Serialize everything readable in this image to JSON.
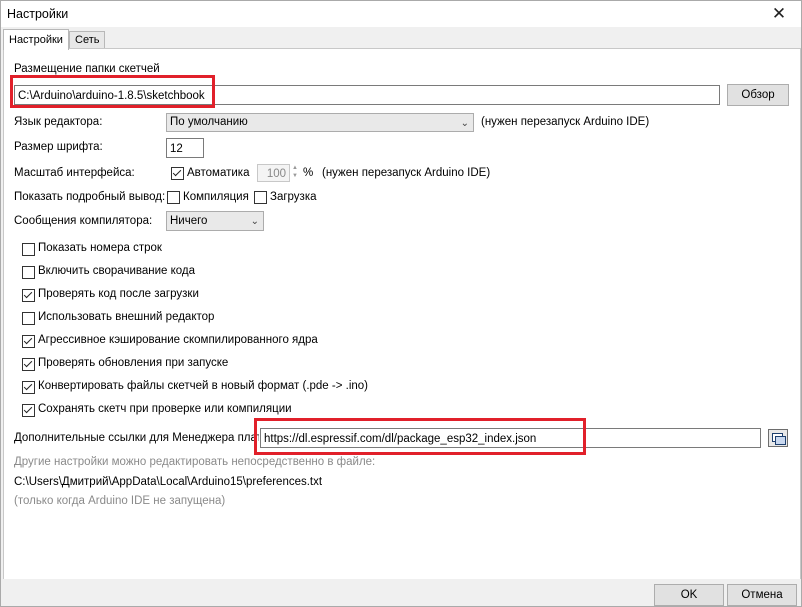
{
  "window": {
    "title": "Настройки"
  },
  "tabs": [
    {
      "label": "Настройки",
      "active": true
    },
    {
      "label": "Сеть",
      "active": false
    }
  ],
  "sketchbook": {
    "label": "Размещение папки скетчей",
    "path": "C:\\Arduino\\arduino-1.8.5\\sketchbook",
    "browse_label": "Обзор"
  },
  "editor_language": {
    "label": "Язык редактора:",
    "value": "По умолчанию",
    "note": "(нужен перезапуск Arduino IDE)"
  },
  "font_size": {
    "label": "Размер шрифта:",
    "value": "12"
  },
  "ui_scale": {
    "label": "Масштаб интерфейса:",
    "auto_label": "Автоматика",
    "auto_checked": true,
    "value": "100",
    "unit": "%",
    "note": "(нужен перезапуск Arduino IDE)"
  },
  "verbose": {
    "label": "Показать подробный вывод:",
    "compile_label": "Компиляция",
    "compile_checked": false,
    "upload_label": "Загрузка",
    "upload_checked": false
  },
  "compiler_warnings": {
    "label": "Сообщения компилятора:",
    "value": "Ничего"
  },
  "options": [
    {
      "label": "Показать номера строк",
      "checked": false
    },
    {
      "label": "Включить сворачивание кода",
      "checked": false
    },
    {
      "label": "Проверять код после загрузки",
      "checked": true
    },
    {
      "label": "Использовать внешний редактор",
      "checked": false
    },
    {
      "label": "Агрессивное кэширование скомпилированного ядра",
      "checked": true
    },
    {
      "label": "Проверять обновления при запуске",
      "checked": true
    },
    {
      "label": "Конвертировать файлы скетчей в новый формат (.pde -> .ino)",
      "checked": true
    },
    {
      "label": "Сохранять скетч при проверке или компиляции",
      "checked": true
    }
  ],
  "board_urls": {
    "label": "Дополнительные ссылки для Менеджера плат:",
    "value": "https://dl.espressif.com/dl/package_esp32_index.json"
  },
  "info": {
    "line1": "Другие настройки можно редактировать непосредственно в файле:",
    "line2": "C:\\Users\\Дмитрий\\AppData\\Local\\Arduino15\\preferences.txt",
    "line3": "(только когда Arduino IDE не запущена)"
  },
  "buttons": {
    "ok": "OK",
    "cancel": "Отмена"
  },
  "colors": {
    "highlight": "#e1202a"
  }
}
